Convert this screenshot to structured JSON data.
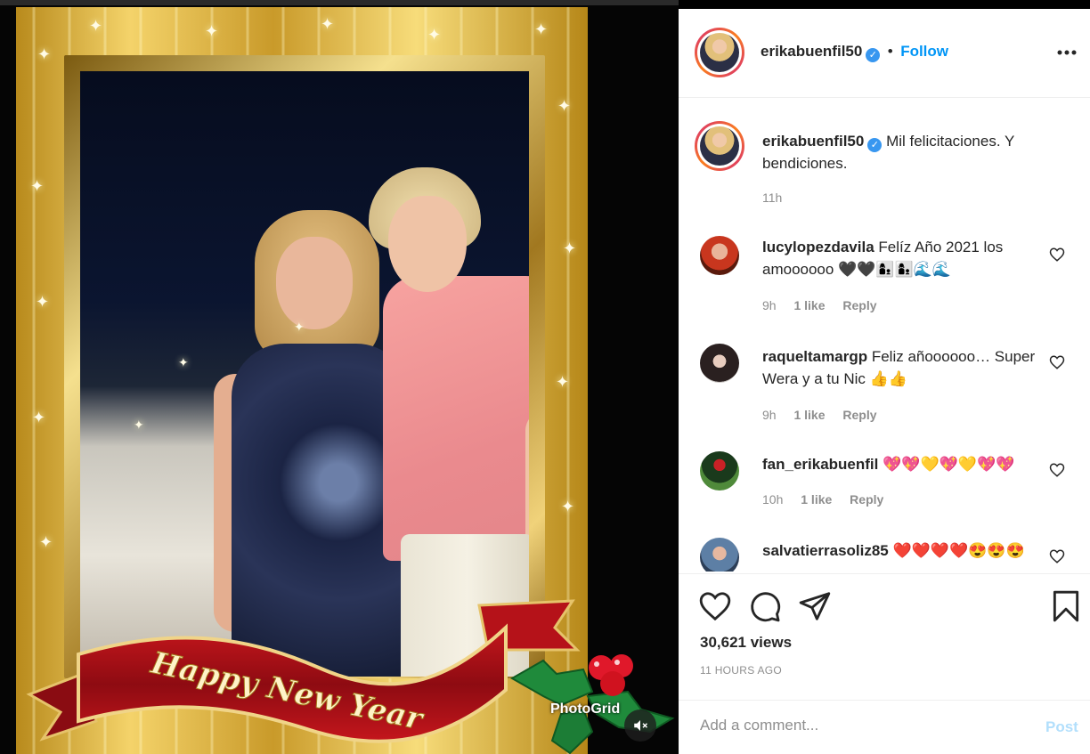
{
  "media": {
    "banner_text": "Happy New Year",
    "watermark": "PhotoGrid",
    "mute_icon": "speaker-muted-icon"
  },
  "post": {
    "author": "erikabuenfil50",
    "follow_label": "Follow",
    "separator": "•",
    "more_icon": "more-horizontal-icon",
    "caption": {
      "username": "erikabuenfil50",
      "text": "Mil felicitaciones. Y bendiciones.",
      "time": "11h"
    },
    "comments": [
      {
        "username": "lucylopezdavila",
        "text": "Felíz Año 2021 los amoooooo 🖤🖤👩‍👦👩‍👦🌊🌊",
        "time": "9h",
        "likes": "1 like",
        "reply": "Reply"
      },
      {
        "username": "raqueltamargp",
        "text": "Feliz añoooooo… Super Wera y a tu Nic 👍👍",
        "time": "9h",
        "likes": "1 like",
        "reply": "Reply"
      },
      {
        "username": "fan_erikabuenfil",
        "text": "💖💖💛💖💛💖💖",
        "time": "10h",
        "likes": "1 like",
        "reply": "Reply"
      },
      {
        "username": "salvatierrasoliz85",
        "text": "❤️❤️❤️❤️😍😍😍",
        "time": "",
        "likes": "",
        "reply": ""
      }
    ],
    "views": "30,621 views",
    "time_ago": "11 HOURS AGO",
    "add_comment_placeholder": "Add a comment...",
    "post_label": "Post"
  },
  "colors": {
    "link_blue": "#0095f6",
    "post_disabled": "#b2dffc",
    "meta_gray": "#8e8e8e",
    "text_dark": "#262626"
  }
}
